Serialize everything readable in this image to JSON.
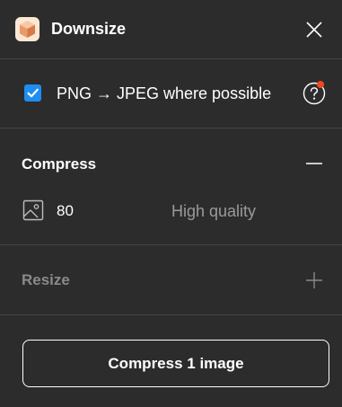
{
  "header": {
    "title": "Downsize",
    "app_icon": "box-icon",
    "close_icon": "close-icon"
  },
  "option": {
    "checked": true,
    "label": "PNG → JPEG where possible",
    "help_icon": "question-circle-icon",
    "notification": true
  },
  "compress": {
    "title": "Compress",
    "expanded": true,
    "toggle_icon": "minus-icon",
    "quality_icon": "image-icon",
    "quality_value": "80",
    "quality_label": "High quality"
  },
  "resize": {
    "title": "Resize",
    "expanded": false,
    "toggle_icon": "plus-icon"
  },
  "action": {
    "button_label": "Compress 1 image"
  },
  "colors": {
    "background": "#2c2c2c",
    "divider": "#444444",
    "accent": "#1e8ef0",
    "notification": "#f24822",
    "muted_text": "#9a9a9a"
  }
}
